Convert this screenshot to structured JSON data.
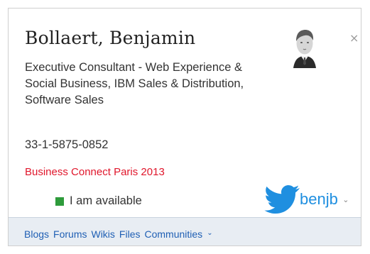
{
  "profile": {
    "name": "Bollaert, Benjamin",
    "job_title": "Executive Consultant - Web Experience & Social Business, IBM Sales & Distribution, Software Sales",
    "phone": "33-1-5875-0852",
    "event_link": "Business Connect Paris 2013",
    "status": "I am available",
    "status_color": "#2e9b3b",
    "event_color": "#e0162b"
  },
  "actions": {
    "close": "×"
  },
  "twitter": {
    "handle": "benjb",
    "more": "⌄",
    "color": "#1f8fe0",
    "icon": "twitter-bird-icon"
  },
  "footer": {
    "links": [
      "Blogs",
      "Forums",
      "Wikis",
      "Files",
      "Communities"
    ],
    "more": "⌄",
    "link_color": "#1f5fb4"
  }
}
